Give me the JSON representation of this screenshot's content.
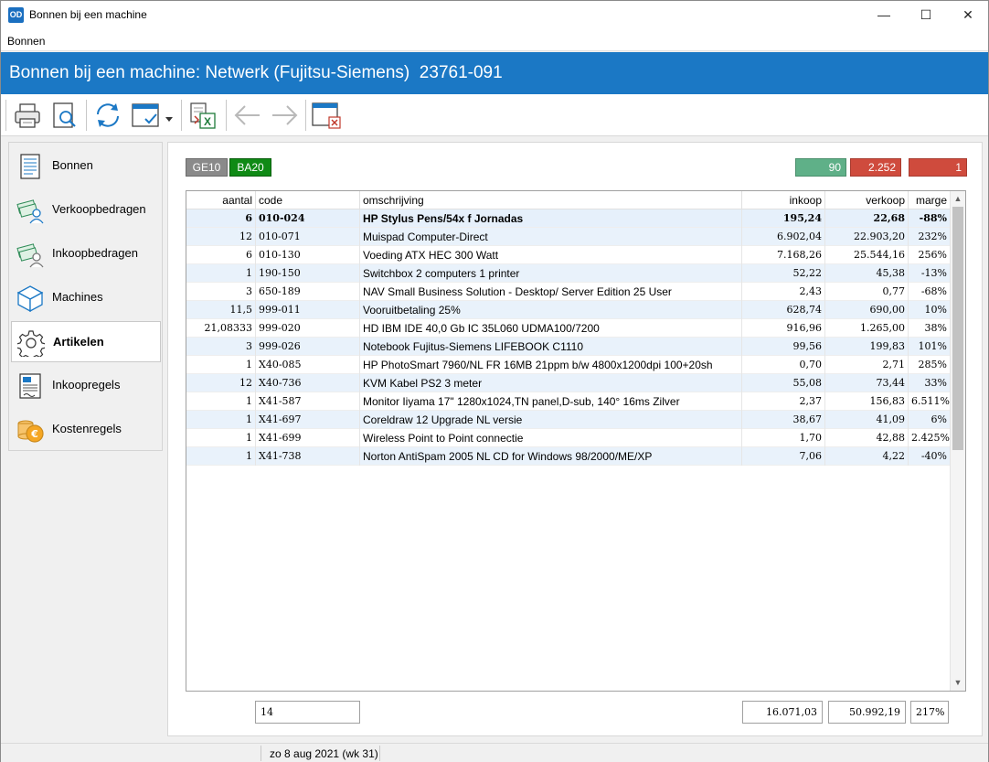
{
  "window": {
    "app_icon_text": "OD",
    "title": "Bonnen bij een machine",
    "min_symbol": "—",
    "max_symbol": "☐",
    "close_symbol": "✕"
  },
  "menu": {
    "items": [
      "Bonnen"
    ]
  },
  "header": {
    "title": "Bonnen bij een machine: Netwerk (Fujitsu-Siemens)  23761-091"
  },
  "toolbar": {
    "buttons": [
      "printer-icon",
      "print-preview-icon",
      "refresh-icon",
      "select-window-icon",
      "dropdown-arrow-icon",
      "export-excel-icon",
      "back-arrow-icon",
      "forward-arrow-icon",
      "close-window-icon"
    ]
  },
  "sidebar": {
    "items": [
      {
        "label": "Bonnen",
        "icon": "document-icon"
      },
      {
        "label": "Verkoopbedragen",
        "icon": "money-user-icon"
      },
      {
        "label": "Inkoopbedragen",
        "icon": "money-user-icon"
      },
      {
        "label": "Machines",
        "icon": "cube-icon"
      },
      {
        "label": "Artikelen",
        "icon": "gear-icon",
        "active": true
      },
      {
        "label": "Inkoopregels",
        "icon": "invoice-icon"
      },
      {
        "label": "Kostenregels",
        "icon": "coins-icon"
      }
    ]
  },
  "badges": {
    "ge": "GE10",
    "ba": "BA20"
  },
  "stats": {
    "a": "90",
    "b": "2.252",
    "c": "1"
  },
  "colors": {
    "header": "#1b78c5",
    "badge_green": "#0f8a15",
    "stat_green": "#5fb088",
    "stat_red": "#cf4b3d"
  },
  "table": {
    "columns": [
      "aantal",
      "code",
      "omschrijving",
      "inkoop",
      "verkoop",
      "marge"
    ],
    "rows": [
      [
        "6",
        "010-024",
        "HP Stylus Pens/54x f Jornadas",
        "195,24",
        "22,68",
        "-88%"
      ],
      [
        "12",
        "010-071",
        "Muispad Computer-Direct",
        "6.902,04",
        "22.903,20",
        "232%"
      ],
      [
        "6",
        "010-130",
        "Voeding ATX HEC 300 Watt",
        "7.168,26",
        "25.544,16",
        "256%"
      ],
      [
        "1",
        "190-150",
        "Switchbox 2 computers 1 printer",
        "52,22",
        "45,38",
        "-13%"
      ],
      [
        "3",
        "650-189",
        "NAV Small Business Solution - Desktop/ Server Edition 25 User",
        "2,43",
        "0,77",
        "-68%"
      ],
      [
        "11,5",
        "999-011",
        "Vooruitbetaling 25%",
        "628,74",
        "690,00",
        "10%"
      ],
      [
        "21,08333",
        "999-020",
        "HD IBM IDE 40,0 Gb IC 35L060 UDMA100/7200",
        "916,96",
        "1.265,00",
        "38%"
      ],
      [
        "3",
        "999-026",
        "Notebook Fujitus-Siemens LIFEBOOK C1110",
        "99,56",
        "199,83",
        "101%"
      ],
      [
        "1",
        "X40-085",
        "HP PhotoSmart 7960/NL FR 16MB 21ppm b/w 4800x1200dpi 100+20sh",
        "0,70",
        "2,71",
        "285%"
      ],
      [
        "12",
        "X40-736",
        "KVM Kabel PS2 3 meter",
        "55,08",
        "73,44",
        "33%"
      ],
      [
        "1",
        "X41-587",
        "Monitor Iiyama 17\" 1280x1024,TN panel,D-sub, 140° 16ms Zilver",
        "2,37",
        "156,83",
        "6.511%"
      ],
      [
        "1",
        "X41-697",
        "Coreldraw 12 Upgrade NL versie",
        "38,67",
        "41,09",
        "6%"
      ],
      [
        "1",
        "X41-699",
        "Wireless Point to Point connectie",
        "1,70",
        "42,88",
        "2.425%"
      ],
      [
        "1",
        "X41-738",
        "Norton AntiSpam 2005 NL CD for Windows 98/2000/ME/XP",
        "7,06",
        "4,22",
        "-40%"
      ]
    ]
  },
  "totals": {
    "count": "14",
    "inkoop": "16.071,03",
    "verkoop": "50.992,19",
    "marge": "217%"
  },
  "status": {
    "date": "zo 8 aug 2021 (wk 31)"
  }
}
